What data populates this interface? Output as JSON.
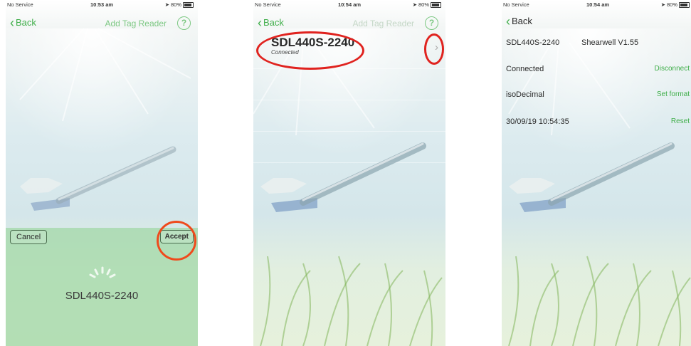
{
  "screens": [
    {
      "status": {
        "service": "No Service",
        "wifi_icon": "wifi-icon",
        "time": "10:53 am",
        "battery": "80%"
      },
      "nav": {
        "back": "Back",
        "title": "Add Tag Reader",
        "help": "?"
      },
      "sheet": {
        "cancel": "Cancel",
        "accept": "Accept",
        "device_name": "SDL440S-2240"
      }
    },
    {
      "status": {
        "service": "No Service",
        "wifi_icon": "wifi-icon",
        "time": "10:54 am",
        "battery": "80%"
      },
      "nav": {
        "back": "Back",
        "title": "Add Tag Reader",
        "help": "?"
      },
      "device": {
        "name": "SDL440S-2240",
        "status": "Connected",
        "disclosure": "›"
      }
    },
    {
      "status": {
        "service": "No Service",
        "wifi_icon": "wifi-icon",
        "time": "10:54 am",
        "battery": "80%"
      },
      "nav": {
        "back": "Back"
      },
      "rows": [
        {
          "left": "SDL440S-2240",
          "right": "Shearwell V1.55",
          "right_style": "gray"
        },
        {
          "left": "Connected",
          "right": "Disconnect",
          "right_style": "green"
        },
        {
          "left": "isoDecimal",
          "right": "Set format",
          "right_style": "green"
        },
        {
          "left": "30/09/19 10:54:35",
          "right": "Reset",
          "right_style": "green"
        }
      ]
    }
  ],
  "colors": {
    "accent_green": "#3fae49",
    "annotation_red": "#e0231f",
    "sheet_green": "#a0d7a5"
  }
}
